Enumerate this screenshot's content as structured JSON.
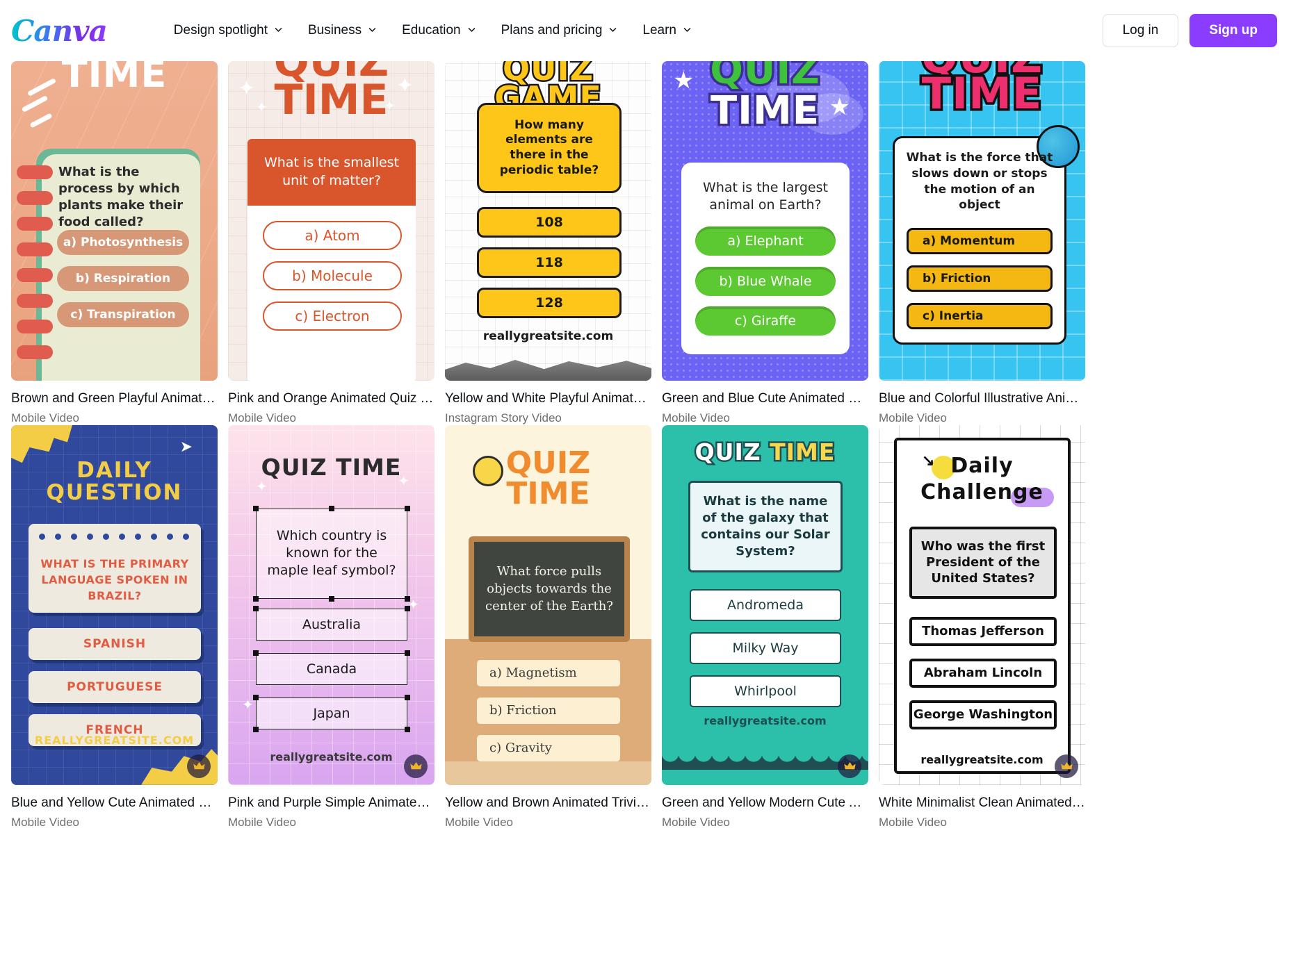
{
  "header": {
    "logo": "Canva",
    "nav": [
      {
        "label": "Design spotlight",
        "icon": "chevron-down-icon"
      },
      {
        "label": "Business",
        "icon": "chevron-down-icon"
      },
      {
        "label": "Education",
        "icon": "chevron-down-icon"
      },
      {
        "label": "Plans and pricing",
        "icon": "chevron-down-icon"
      },
      {
        "label": "Learn",
        "icon": "chevron-down-icon"
      }
    ],
    "login_label": "Log in",
    "signup_label": "Sign up",
    "accent_color": "#8b3dff"
  },
  "cards": [
    {
      "title": "Brown and Green Playful Animated Qui...",
      "subtitle": "Mobile Video",
      "pro": false,
      "design": {
        "heading": "TIME",
        "question": "What is the process by which plants make their food called?",
        "options": [
          "a) Photosynthesis",
          "b) Respiration",
          "c) Transpiration"
        ]
      }
    },
    {
      "title": "Pink and Orange Animated Quiz Time M...",
      "subtitle": "Mobile Video",
      "pro": false,
      "design": {
        "heading": "QUIZ TIME",
        "question": "What is the smallest unit of matter?",
        "options": [
          "a) Atom",
          "b) Molecule",
          "c) Electron"
        ]
      }
    },
    {
      "title": "Yellow and White Playful Animated Qui...",
      "subtitle": "Instagram Story Video",
      "pro": false,
      "design": {
        "heading": "QUIZ GAME",
        "question": "How many elements are there in the periodic table?",
        "options": [
          "108",
          "118",
          "128"
        ],
        "website": "reallygreatsite.com"
      }
    },
    {
      "title": "Green and Blue Cute Animated Quiz Ti...",
      "subtitle": "Mobile Video",
      "pro": false,
      "design": {
        "heading_line1": "QUIZ",
        "heading_line2": "TIME",
        "question": "What is the largest animal on Earth?",
        "options": [
          "a) Elephant",
          "b) Blue Whale",
          "c) Giraffe"
        ]
      }
    },
    {
      "title": "Blue and Colorful Illustrative Animated ...",
      "subtitle": "Mobile Video",
      "pro": false,
      "design": {
        "heading_line1": "QUIZ",
        "heading_line2": "TIME",
        "question": "What is the force that slows down or stops the motion of an object",
        "options": [
          "a) Momentum",
          "b) Friction",
          "c) Inertia"
        ]
      }
    },
    {
      "title": "Blue and Yellow Cute Animated Quiz Ti...",
      "subtitle": "Mobile Video",
      "pro": true,
      "design": {
        "heading_line1": "DAILY",
        "heading_line2": "QUESTION",
        "question": "WHAT IS THE PRIMARY LANGUAGE SPOKEN IN BRAZIL?",
        "options": [
          "SPANISH",
          "PORTUGUESE",
          "FRENCH"
        ],
        "website": "REALLYGREATSITE.COM"
      }
    },
    {
      "title": "Pink and Purple Simple Animated Quiz ...",
      "subtitle": "Mobile Video",
      "pro": true,
      "design": {
        "heading": "QUIZ TIME",
        "question": "Which country is known for the maple leaf symbol?",
        "options": [
          "Australia",
          "Canada",
          "Japan"
        ],
        "website": "reallygreatsite.com"
      }
    },
    {
      "title": "Yellow and Brown Animated Trivia Quiz ...",
      "subtitle": "Mobile Video",
      "pro": false,
      "design": {
        "heading_line1": "QUIZ",
        "heading_line2": "TIME",
        "question": "What force pulls objects towards the center of the Earth?",
        "options": [
          "a) Magnetism",
          "b) Friction",
          "c) Gravity"
        ]
      }
    },
    {
      "title": "Green and Yellow Modern Cute Animat...",
      "subtitle": "Mobile Video",
      "pro": true,
      "design": {
        "heading_part1": "QUIZ",
        "heading_part2": "TIME",
        "question": "What is the name of the galaxy that contains our Solar System?",
        "options": [
          "Andromeda",
          "Milky Way",
          "Whirlpool"
        ],
        "website": "reallygreatsite.com"
      }
    },
    {
      "title": "White Minimalist Clean Animated Daily ...",
      "subtitle": "Mobile Video",
      "pro": true,
      "design": {
        "heading_line1": "Daily",
        "heading_line2": "Challenge",
        "question": "Who was the first President of the United States?",
        "options": [
          "Thomas Jefferson",
          "Abraham Lincoln",
          "George Washington"
        ],
        "website": "reallygreatsite.com"
      }
    }
  ]
}
